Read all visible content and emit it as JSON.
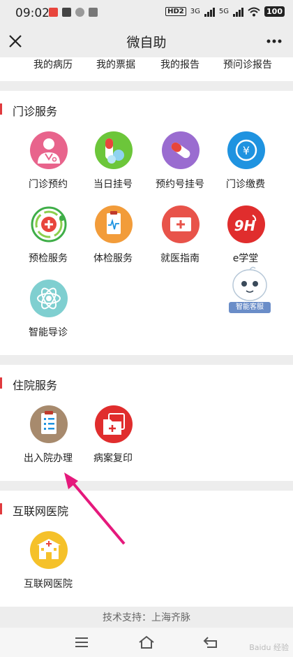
{
  "status_bar": {
    "time": "09:02",
    "network": "HD2",
    "sig1": "3G",
    "sig2": "5G",
    "battery": "100"
  },
  "title_bar": {
    "title": "微自助"
  },
  "quick_links": [
    "我的病历",
    "我的票据",
    "我的报告",
    "预问诊报告"
  ],
  "outpatient": {
    "title": "门诊服务",
    "items": [
      {
        "label": "门诊预约",
        "icon": "doctor-icon",
        "color": "#e8648c"
      },
      {
        "label": "当日挂号",
        "icon": "pill-icon",
        "color": "#6cc63a"
      },
      {
        "label": "预约号挂号",
        "icon": "capsule-icon",
        "color": "#9a6cd0"
      },
      {
        "label": "门诊缴费",
        "icon": "yuan-coin-icon",
        "color": "#1f93e0"
      },
      {
        "label": "预检服务",
        "icon": "green-swirl-icon",
        "color": "#3fae48"
      },
      {
        "label": "体检服务",
        "icon": "clipboard-ecg-icon",
        "color": "#f29c3a"
      },
      {
        "label": "就医指南",
        "icon": "first-aid-kit-icon",
        "color": "#e8534a"
      },
      {
        "label": "e学堂",
        "icon": "e-school-icon",
        "color": "#e02d2d"
      },
      {
        "label": "智能导诊",
        "icon": "atom-icon",
        "color": "#7fcfd0"
      }
    ]
  },
  "inpatient": {
    "title": "住院服务",
    "items": [
      {
        "label": "出入院办理",
        "icon": "admission-checklist-icon",
        "color": "#a78a6d"
      },
      {
        "label": "病案复印",
        "icon": "medical-folder-icon",
        "color": "#e02d2d"
      }
    ]
  },
  "internet_hospital": {
    "title": "互联网医院",
    "items": [
      {
        "label": "互联网医院",
        "icon": "hospital-building-icon",
        "color": "#f5c12a"
      }
    ]
  },
  "ai_assistant": {
    "label": "智能客服"
  },
  "footer": {
    "text": "技术支持：上海齐脉"
  },
  "watermark": "Baidu 经验"
}
